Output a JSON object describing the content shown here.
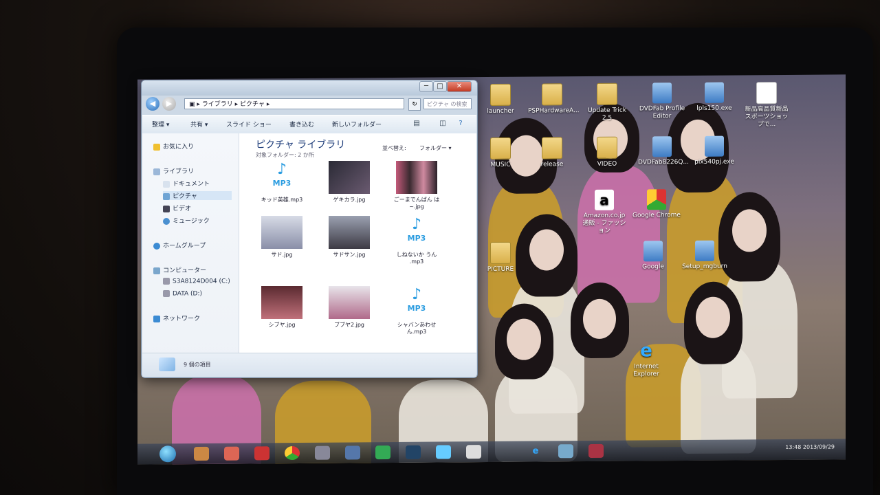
{
  "window": {
    "address": [
      "ライブラリ",
      "ピクチャ"
    ],
    "search_placeholder": "ピクチャ の検索",
    "nav_back_symbol": "◀",
    "nav_forward_symbol": "▶",
    "refresh_symbol": "↻",
    "minimize": "─",
    "maximize": "□",
    "close": "✕",
    "toolbar": {
      "organize": "整理 ▾",
      "share": "共有 ▾",
      "slideshow": "スライド ショー",
      "burn": "書き込む",
      "new_folder": "新しいフォルダー"
    },
    "library": {
      "title": "ピクチャ ライブラリ",
      "subtitle": "対象フォルダー: 2 か所",
      "arrange": "並べ替え:",
      "arrange_value": "フォルダー ▾"
    },
    "nav": {
      "favorites": "お気に入り",
      "libraries": "ライブラリ",
      "documents": "ドキュメント",
      "pictures": "ピクチャ",
      "videos": "ビデオ",
      "music": "ミュージック",
      "homegroup": "ホームグループ",
      "computer": "コンピューター",
      "drive_c": "S3A8124D004 (C:)",
      "drive_d": "DATA (D:)",
      "network": "ネットワーク"
    },
    "files": [
      {
        "name": "キッド英雄.mp3",
        "kind": "mp3"
      },
      {
        "name": "ゲキカラ.jpg",
        "kind": "img"
      },
      {
        "name": "ごーまでんばん は~.jpg",
        "kind": "img"
      },
      {
        "name": "サド.jpg",
        "kind": "img"
      },
      {
        "name": "サドサン.jpg",
        "kind": "img"
      },
      {
        "name": "しねないか うん .mp3",
        "kind": "mp3"
      },
      {
        "name": "シブヤ.jpg",
        "kind": "img"
      },
      {
        "name": "ブブヤ2.jpg",
        "kind": "img"
      },
      {
        "name": "シャバンあわせ ん.mp3",
        "kind": "mp3"
      }
    ],
    "status": "9 個の項目"
  },
  "desktop_icons": [
    {
      "label": "launcher",
      "type": "folder"
    },
    {
      "label": "PSPHardwareA...",
      "type": "folder"
    },
    {
      "label": "Update Trick 2.5",
      "type": "folder"
    },
    {
      "label": "DVDFab Profile Editor",
      "type": "exe"
    },
    {
      "label": "lpls150.exe",
      "type": "exe"
    },
    {
      "label": "新品高品質新品スポーツショップで...",
      "type": "file"
    },
    {
      "label": "MUSIC",
      "type": "folder"
    },
    {
      "label": "release",
      "type": "folder"
    },
    {
      "label": "VIDEO",
      "type": "folder"
    },
    {
      "label": "DVDFab8226Q...",
      "type": "exe"
    },
    {
      "label": "pix540pj.exe",
      "type": "exe"
    },
    {
      "label": "Amazon.co.jp 通販 - ファッション",
      "type": "amazon"
    },
    {
      "label": "Google Chrome",
      "type": "chrome"
    },
    {
      "label": "PICTURE",
      "type": "folder"
    },
    {
      "label": "Google",
      "type": "exe"
    },
    {
      "label": "Setup_mgburn",
      "type": "exe"
    },
    {
      "label": "Internet Explorer",
      "type": "ie"
    }
  ],
  "mp3_label": "MP3",
  "music_note": "♪",
  "taskbar": {
    "clock": "13:48",
    "date": "2013/09/29"
  },
  "colors": {
    "accent": "#2a9ce0",
    "title_text": "#1e3d7a"
  }
}
